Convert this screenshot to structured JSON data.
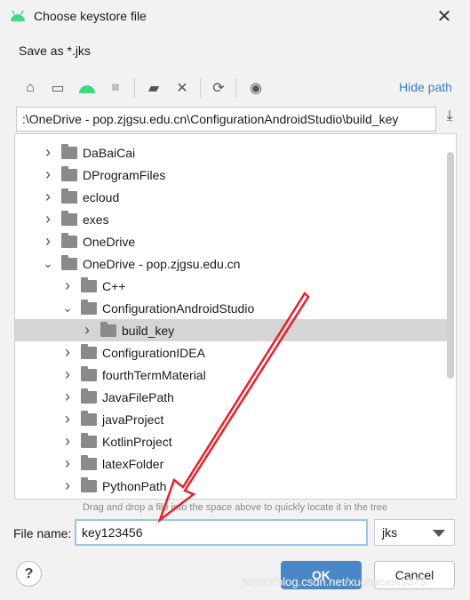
{
  "window": {
    "title": "Choose keystore file",
    "close_icon": "close-icon"
  },
  "subtitle": "Save as *.jks",
  "toolbar": {
    "icons": [
      "home-icon",
      "desktop-icon",
      "android-icon",
      "project-folder-icon",
      "new-folder-icon",
      "delete-icon",
      "refresh-icon",
      "show-hidden-icon"
    ],
    "hide_path": "Hide path",
    "android_color": "#3ddc84"
  },
  "path": ":\\OneDrive - pop.zjgsu.edu.cn\\ConfigurationAndroidStudio\\build_key",
  "tree": [
    {
      "label": "DaBaiCai",
      "level": 1,
      "expanded": false
    },
    {
      "label": "DProgramFiles",
      "level": 1,
      "expanded": false
    },
    {
      "label": "ecloud",
      "level": 1,
      "expanded": false
    },
    {
      "label": "exes",
      "level": 1,
      "expanded": false
    },
    {
      "label": "OneDrive",
      "level": 1,
      "expanded": false
    },
    {
      "label": "OneDrive - pop.zjgsu.edu.cn",
      "level": 1,
      "expanded": true
    },
    {
      "label": "C++",
      "level": 2,
      "expanded": false
    },
    {
      "label": "ConfigurationAndroidStudio",
      "level": 2,
      "expanded": true
    },
    {
      "label": "build_key",
      "level": 3,
      "expanded": false,
      "selected": true
    },
    {
      "label": "ConfigurationIDEA",
      "level": 2,
      "expanded": false
    },
    {
      "label": "fourthTermMaterial",
      "level": 2,
      "expanded": false
    },
    {
      "label": "JavaFilePath",
      "level": 2,
      "expanded": false
    },
    {
      "label": "javaProject",
      "level": 2,
      "expanded": false
    },
    {
      "label": "KotlinProject",
      "level": 2,
      "expanded": false
    },
    {
      "label": "latexFolder",
      "level": 2,
      "expanded": false
    },
    {
      "label": "PythonPath",
      "level": 2,
      "expanded": false
    }
  ],
  "hint": "Drag and drop a file into the space above to quickly locate it in the tree",
  "file_name": {
    "label": "File name:",
    "value": "key123456"
  },
  "extension": "jks",
  "buttons": {
    "help": "?",
    "ok": "OK",
    "cancel": "Cancel"
  },
  "watermark": "https://blog.csdn.net/xuchaoxin1375",
  "annotation_color": "#e8202a"
}
